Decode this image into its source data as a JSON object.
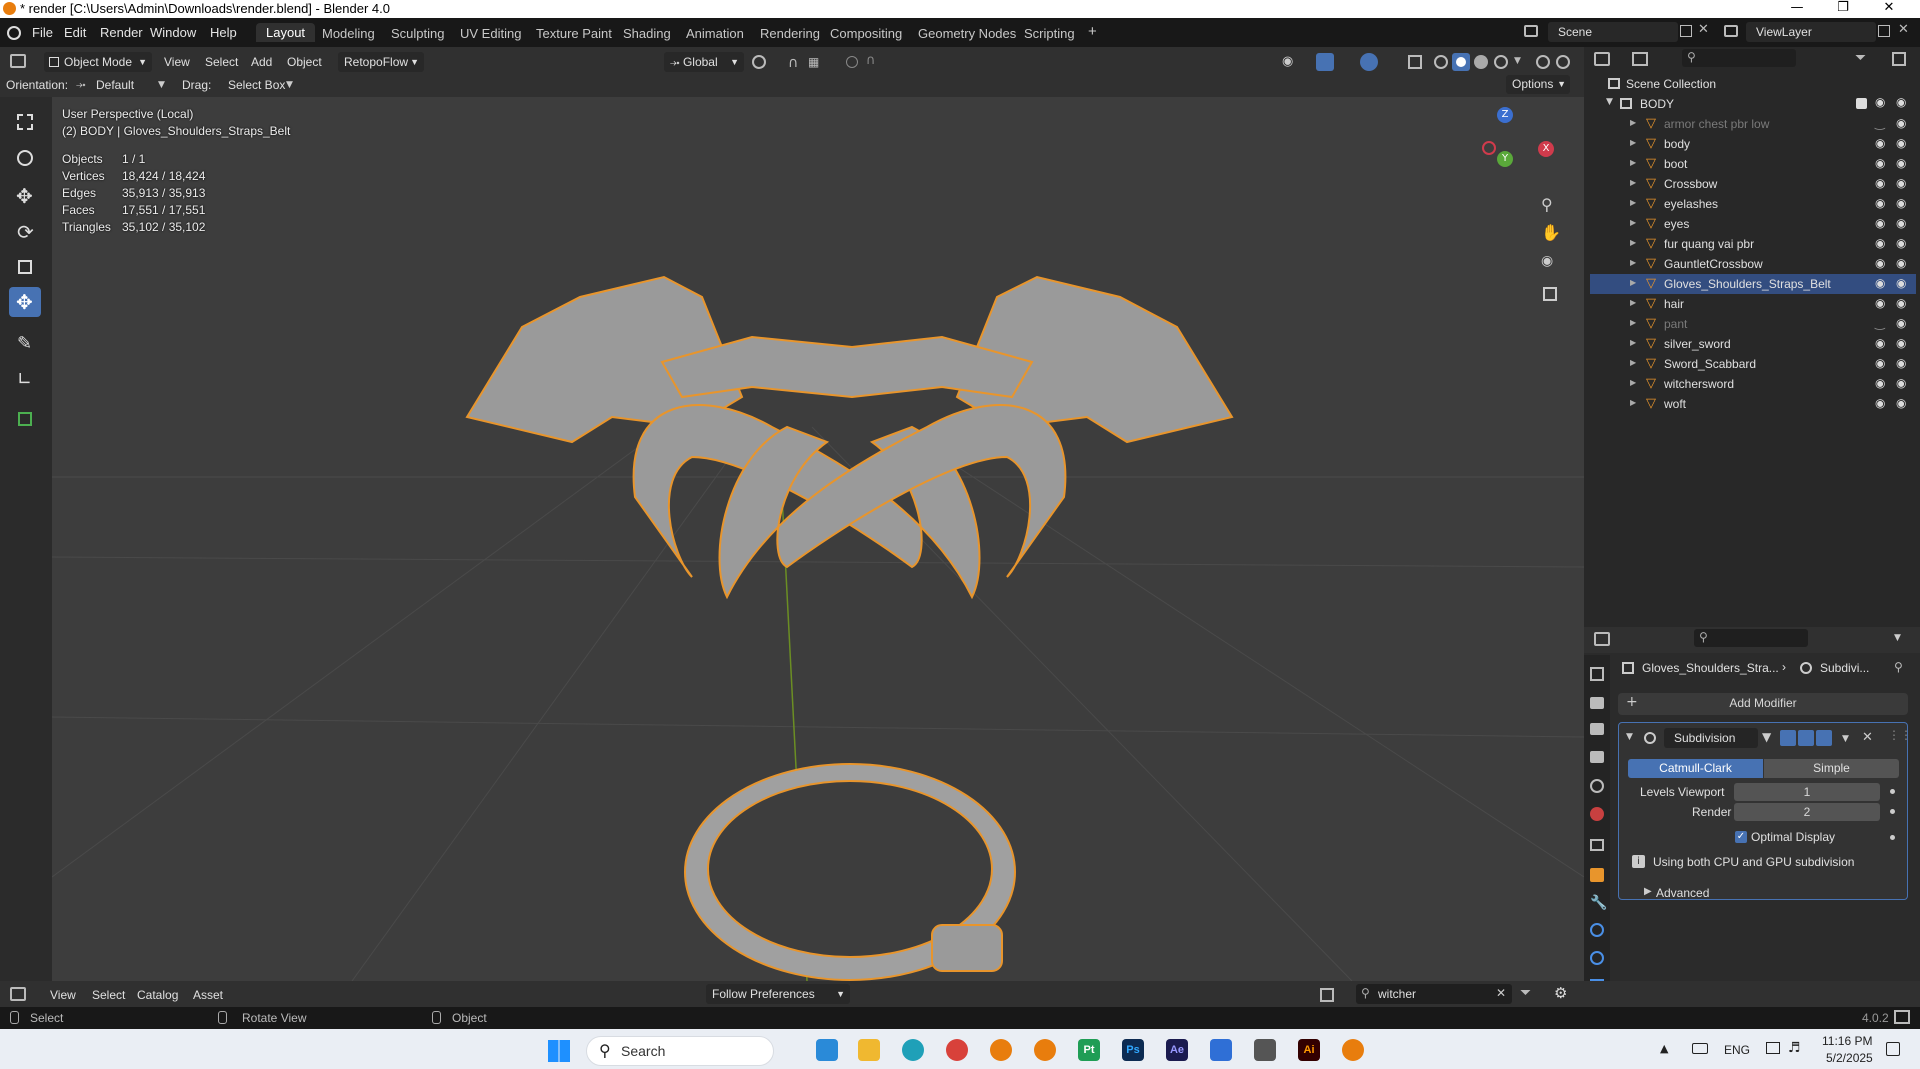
{
  "window": {
    "title": "* render [C:\\Users\\Admin\\Downloads\\render.blend] - Blender 4.0"
  },
  "menu": {
    "file": "File",
    "edit": "Edit",
    "render": "Render",
    "window": "Window",
    "help": "Help"
  },
  "workspaces": [
    "Layout",
    "Modeling",
    "Sculpting",
    "UV Editing",
    "Texture Paint",
    "Shading",
    "Animation",
    "Rendering",
    "Compositing",
    "Geometry Nodes",
    "Scripting"
  ],
  "scene": {
    "name": "Scene",
    "view_layer": "ViewLayer"
  },
  "header": {
    "mode": "Object Mode",
    "view": "View",
    "select": "Select",
    "add": "Add",
    "object": "Object",
    "retopoflow": "RetopoFlow",
    "transform": "Global",
    "orientation_label": "Orientation:",
    "orientation": "Default",
    "drag_label": "Drag:",
    "drag": "Select Box",
    "options": "Options"
  },
  "viewport": {
    "title": "User Perspective (Local)",
    "subtitle": "(2) BODY | Gloves_Shoulders_Straps_Belt",
    "stats": [
      {
        "label": "Objects",
        "value": "1 / 1"
      },
      {
        "label": "Vertices",
        "value": "18,424 / 18,424"
      },
      {
        "label": "Edges",
        "value": "35,913 / 35,913"
      },
      {
        "label": "Faces",
        "value": "17,551 / 17,551"
      },
      {
        "label": "Triangles",
        "value": "35,102 / 35,102"
      }
    ],
    "gizmo": {
      "z": "Z",
      "x": "X",
      "y": "Y"
    }
  },
  "outliner": {
    "root": "Scene Collection",
    "collection": "BODY",
    "items": [
      {
        "name": "armor chest pbr low",
        "hidden": true
      },
      {
        "name": "body",
        "hidden": false
      },
      {
        "name": "boot",
        "hidden": false
      },
      {
        "name": "Crossbow",
        "hidden": false
      },
      {
        "name": "eyelashes",
        "hidden": false
      },
      {
        "name": "eyes",
        "hidden": false
      },
      {
        "name": "fur quang vai pbr",
        "hidden": false
      },
      {
        "name": "GauntletCrossbow",
        "hidden": false
      },
      {
        "name": "Gloves_Shoulders_Straps_Belt",
        "hidden": false,
        "selected": true
      },
      {
        "name": "hair",
        "hidden": false
      },
      {
        "name": "pant",
        "hidden": true
      },
      {
        "name": "silver_sword",
        "hidden": false
      },
      {
        "name": "Sword_Scabbard",
        "hidden": false
      },
      {
        "name": "witchersword",
        "hidden": false
      },
      {
        "name": "woft",
        "hidden": false
      }
    ]
  },
  "properties": {
    "breadcrumb_object": "Gloves_Shoulders_Stra...",
    "breadcrumb_modifier": "Subdivi...",
    "add_modifier": "Add Modifier",
    "modifier_name": "Subdivision",
    "mode_catmull": "Catmull-Clark",
    "mode_simple": "Simple",
    "levels_viewport_label": "Levels Viewport",
    "levels_viewport": "1",
    "render_label": "Render",
    "render_value": "2",
    "optimal_display": "Optimal Display",
    "info": "Using both CPU and GPU subdivision",
    "advanced": "Advanced"
  },
  "assetbar": {
    "view": "View",
    "select": "Select",
    "catalog": "Catalog",
    "asset": "Asset",
    "follow": "Follow Preferences",
    "search": "witcher"
  },
  "status": {
    "select": "Select",
    "rotate": "Rotate View",
    "object": "Object",
    "version": "4.0.2"
  },
  "taskbar": {
    "search": "Search",
    "lang": "ENG",
    "time": "11:16 PM",
    "date": "5/2/2025"
  },
  "colors": {
    "accent": "#4772b3",
    "selection_orange": "#e8952c",
    "viewport_bg": "#3d3d3d"
  }
}
